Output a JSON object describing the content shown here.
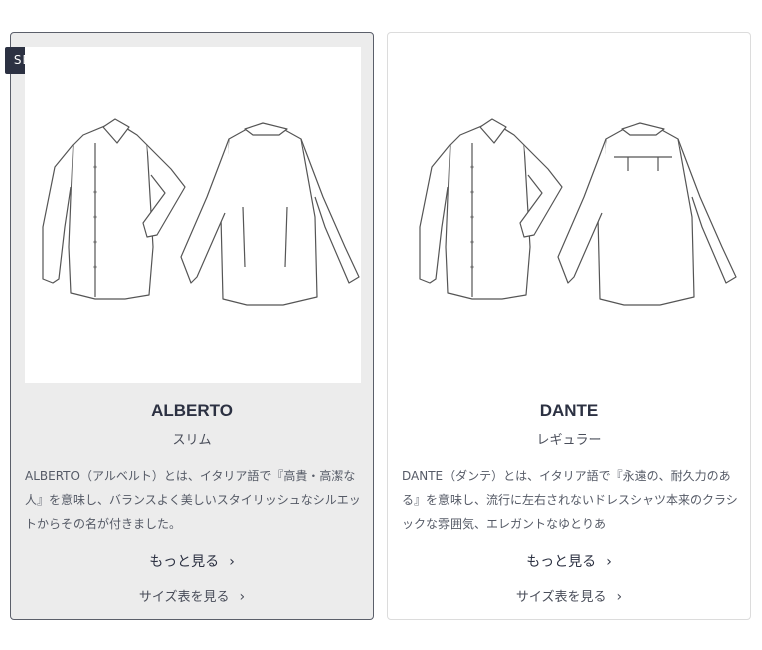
{
  "badge": "SELECT",
  "products": [
    {
      "name": "ALBERTO",
      "fit": "スリム",
      "description": "ALBERTO（アルベルト）とは、イタリア語で『高貴・高潔な人』を意味し、バランスよく美しいスタイリッシュなシルエットからその名が付きました。",
      "more_link": "もっと見る",
      "size_link": "サイズ表を見る",
      "image_icon": "shirt-front-back-icon"
    },
    {
      "name": "DANTE",
      "fit": "レギュラー",
      "description": "DANTE（ダンテ）とは、イタリア語で『永遠の、耐久力のある』を意味し、流行に左右されないドレスシャツ本来のクラシックな雰囲気、エレガントなゆとりあ",
      "more_link": "もっと見る",
      "size_link": "サイズ表を見る",
      "image_icon": "shirt-front-back-icon"
    }
  ],
  "chevron_icon": "chevron-right-icon",
  "colors": {
    "badge_bg": "#2c3142",
    "selected_bg": "#ececec",
    "selected_border": "#5b5f6a"
  }
}
